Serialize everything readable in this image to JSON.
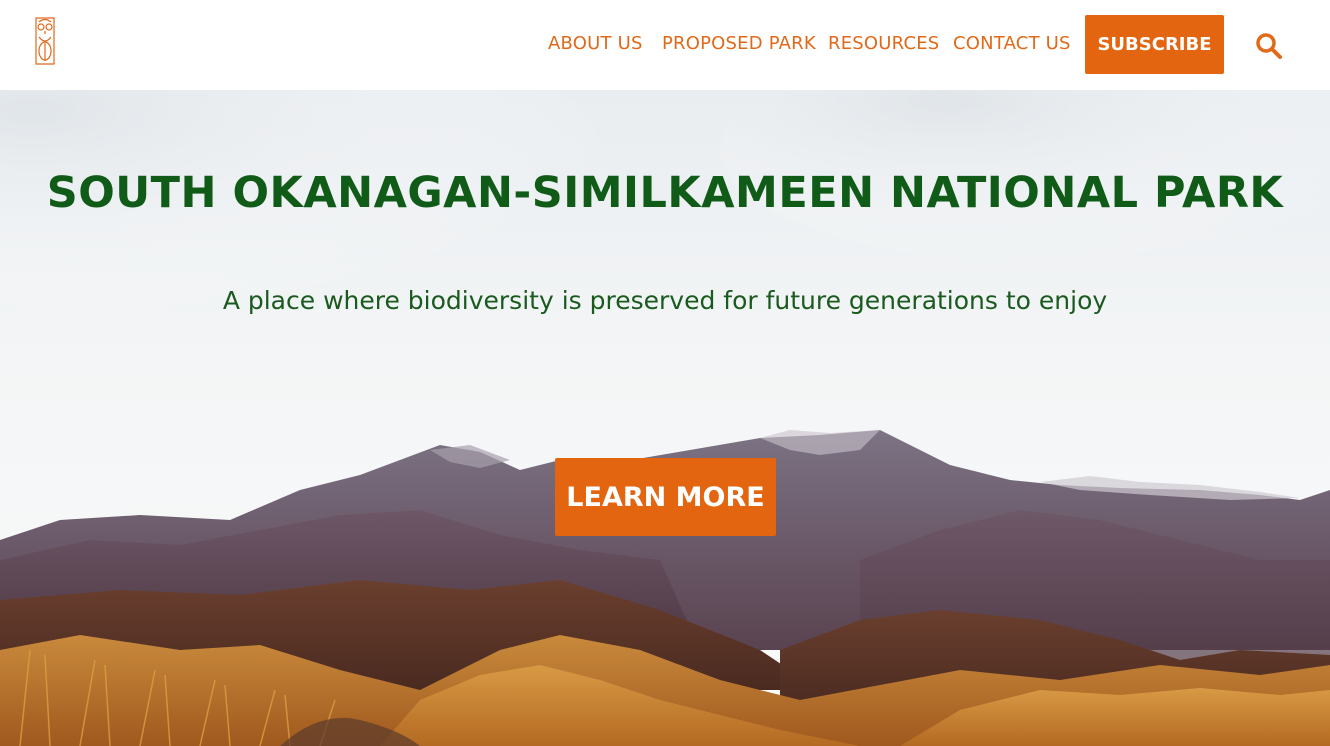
{
  "brand": {
    "logo_icon": "owl-logo-icon",
    "accent_color": "#e4650f",
    "title_color": "#0f5b17"
  },
  "nav": {
    "items": [
      {
        "label": "ABOUT US"
      },
      {
        "label": "PROPOSED PARK"
      },
      {
        "label": "RESOURCES"
      },
      {
        "label": "CONTACT US"
      }
    ],
    "subscribe_label": "SUBSCRIBE",
    "search_icon": "search-icon"
  },
  "hero": {
    "title": "SOUTH OKANAGAN-SIMILKAMEEN NATIONAL PARK",
    "subtitle": "A place where biodiversity is preserved for future generations to enjoy",
    "cta_label": "LEARN MORE"
  }
}
